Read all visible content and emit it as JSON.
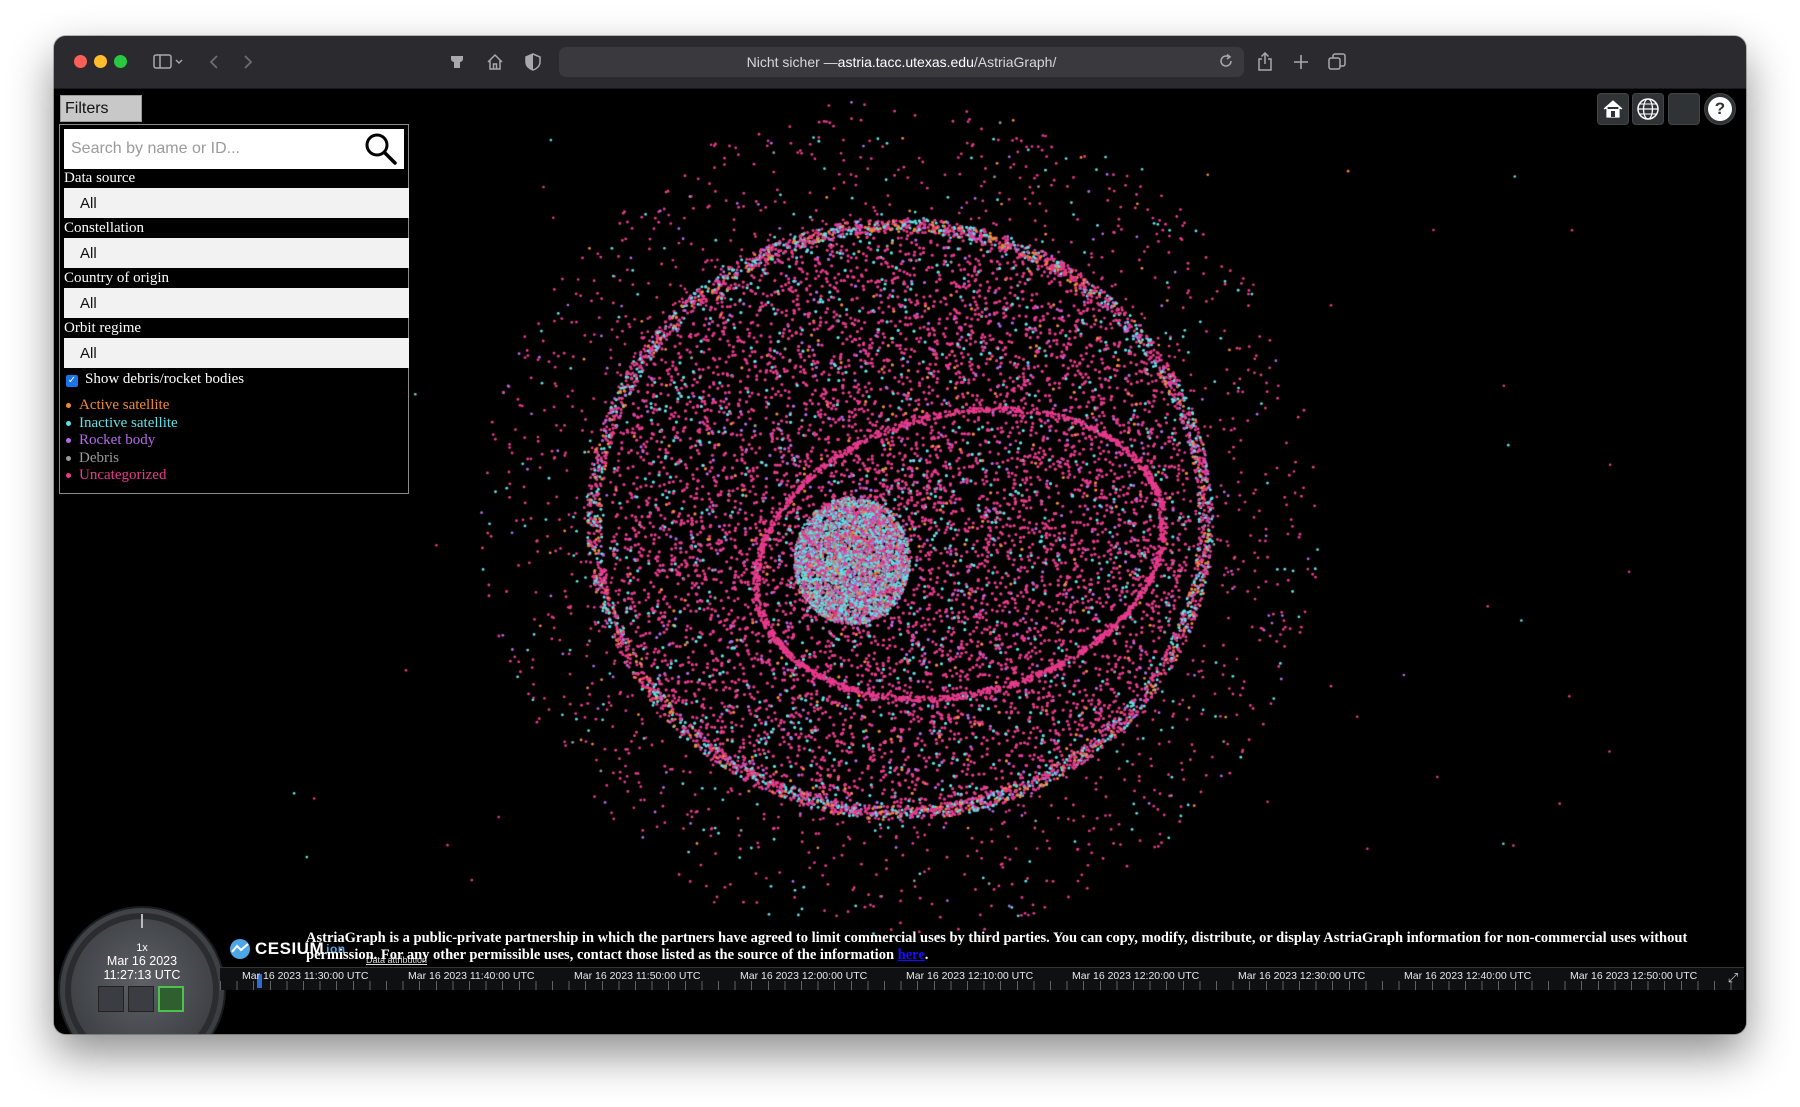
{
  "browser": {
    "address_prefix": "Nicht sicher — ",
    "address_host": "astria.tacc.utexas.edu",
    "address_path": "/AstriaGraph/"
  },
  "filters": {
    "toggle_label": "Filters",
    "search_placeholder": "Search by name or ID...",
    "fields": [
      {
        "label": "Data source",
        "value": "All"
      },
      {
        "label": "Constellation",
        "value": "All"
      },
      {
        "label": "Country of origin",
        "value": "All"
      },
      {
        "label": "Orbit regime",
        "value": "All"
      }
    ],
    "show_debris_label": "Show debris/rocket bodies",
    "show_debris_checked": true
  },
  "legend": [
    {
      "label": "Active satellite",
      "color": "#f28a35"
    },
    {
      "label": "Inactive satellite",
      "color": "#5fe0e6"
    },
    {
      "label": "Rocket body",
      "color": "#b56ae6"
    },
    {
      "label": "Debris",
      "color": "#9a9a9a"
    },
    {
      "label": "Uncategorized",
      "color": "#e83a8c"
    }
  ],
  "toolbar": {
    "home_icon": "home-icon",
    "globe_icon": "globe-icon",
    "help_label": "?"
  },
  "clock": {
    "speed": "1x",
    "date": "Mar 16 2023",
    "time": "11:27:13 UTC"
  },
  "branding": {
    "cesium_label": "CESIUM",
    "cesium_suffix": "ion",
    "attribution_link": "Data attribution"
  },
  "notice": {
    "text": "AstriaGraph is a public-private partnership in which the partners have agreed to limit commercial uses by third parties. You can copy, modify, distribute, or display AstriaGraph information for non-commercial uses without permission. For any other permissible uses, contact those listed as the source of the information ",
    "link_text": "here",
    "end": "."
  },
  "timeline": {
    "labels": [
      "Mar 16 2023 11:30:00 UTC",
      "Mar 16 2023 11:40:00 UTC",
      "Mar 16 2023 11:50:00 UTC",
      "Mar 16 2023 12:00:00 UTC",
      "Mar 16 2023 12:10:00 UTC",
      "Mar 16 2023 12:20:00 UTC",
      "Mar 16 2023 12:30:00 UTC",
      "Mar 16 2023 12:40:00 UTC",
      "Mar 16 2023 12:50:00 UTC"
    ]
  }
}
